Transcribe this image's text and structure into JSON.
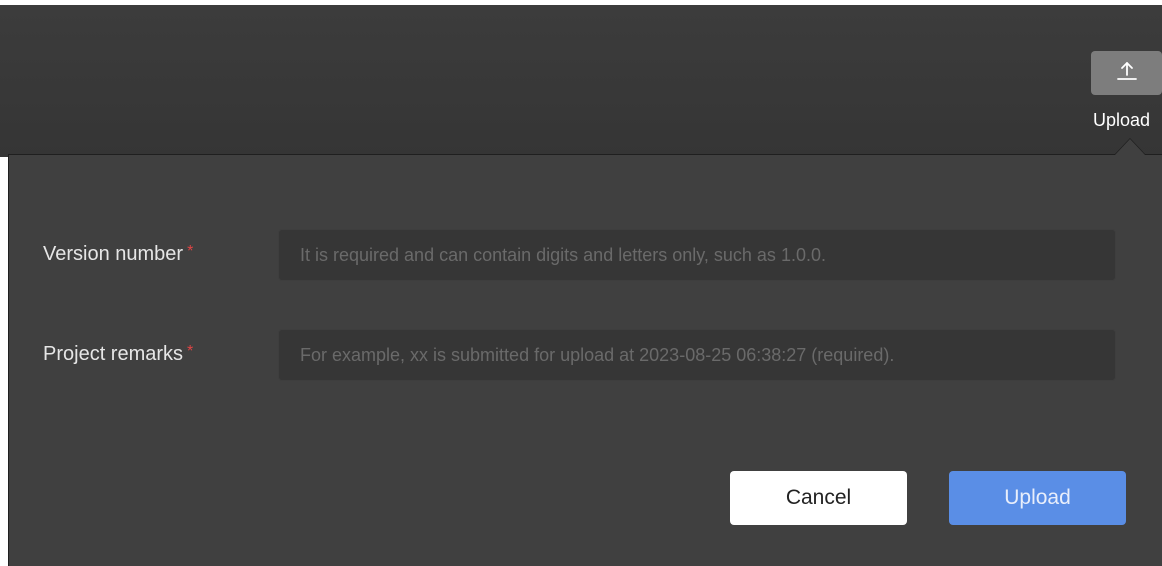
{
  "toolbar": {
    "upload_label": "Upload",
    "upload_icon": "upload-icon"
  },
  "form": {
    "version": {
      "label": "Version number",
      "required_mark": "*",
      "value": "",
      "placeholder": "It is required and can contain digits and letters only, such as 1.0.0."
    },
    "remarks": {
      "label": "Project remarks",
      "required_mark": "*",
      "value": "",
      "placeholder": "For example, xx is submitted for upload at 2023-08-25 06:38:27 (required)."
    }
  },
  "actions": {
    "cancel_label": "Cancel",
    "upload_label": "Upload"
  },
  "colors": {
    "toolbar_bg": "#3a3a3a",
    "panel_bg": "#404040",
    "input_bg": "#363636",
    "required": "#e04444",
    "primary": "#5a8ee6"
  }
}
